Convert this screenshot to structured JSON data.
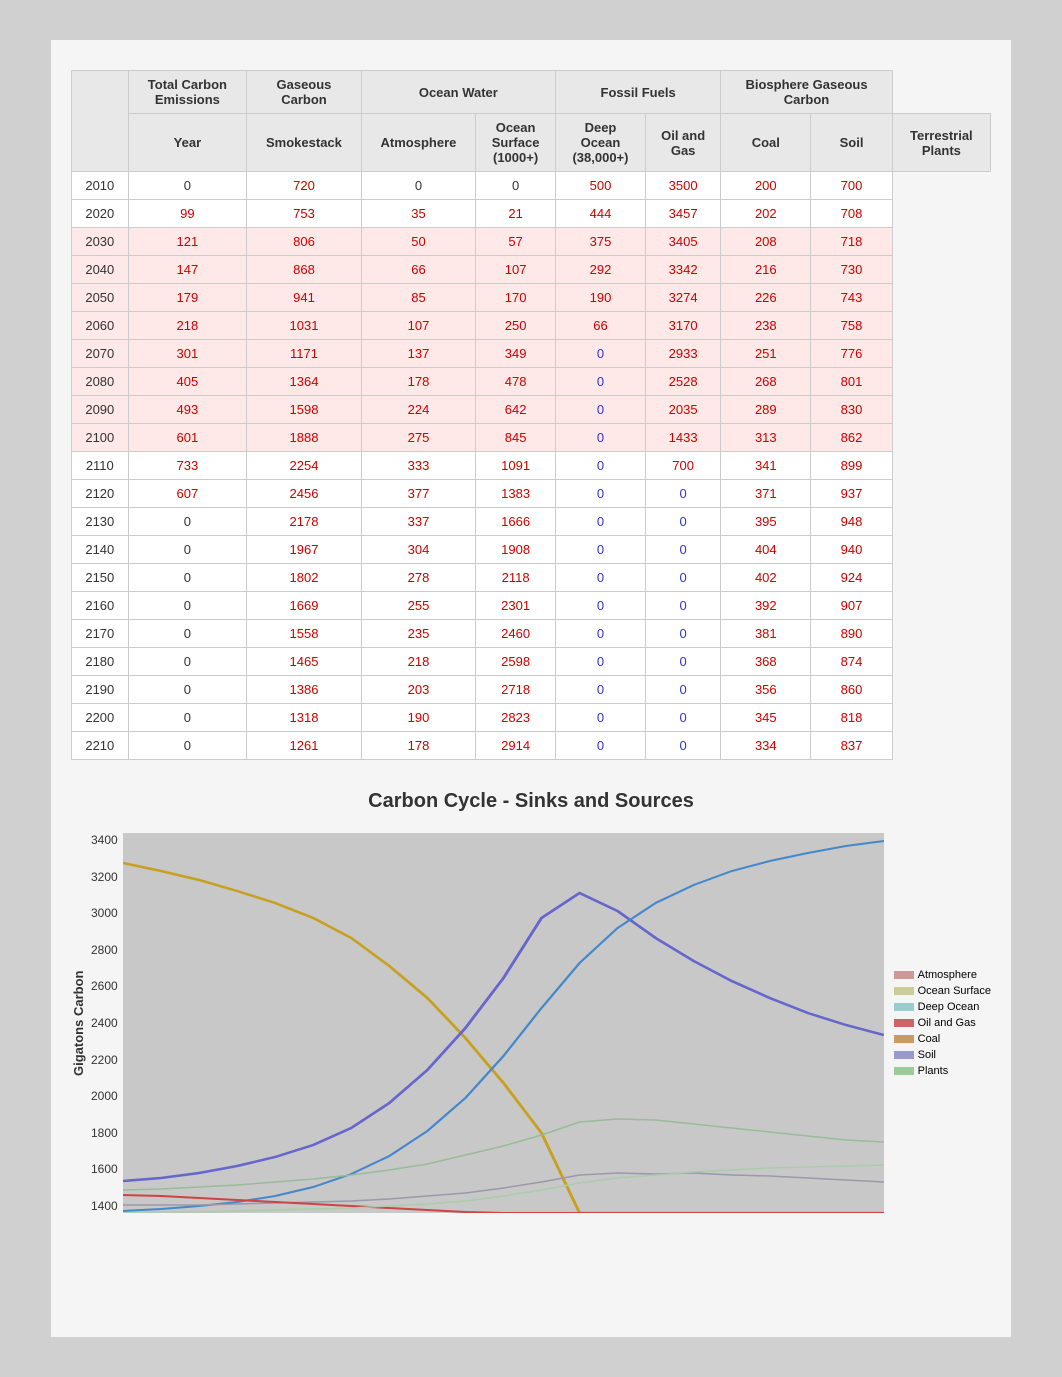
{
  "table": {
    "headers": {
      "row1": [
        {
          "label": "",
          "colspan": 1,
          "rowspan": 2
        },
        {
          "label": "Total Carbon\nEmissions",
          "colspan": 1,
          "rowspan": 1
        },
        {
          "label": "Gaseous\nCarbon",
          "colspan": 1,
          "rowspan": 1
        },
        {
          "label": "Ocean Water",
          "colspan": 2,
          "rowspan": 1
        },
        {
          "label": "Fossil Fuels",
          "colspan": 2,
          "rowspan": 1
        },
        {
          "label": "Biosphere Gaseous\nCarbon",
          "colspan": 2,
          "rowspan": 1
        }
      ],
      "row2": [
        {
          "label": "Year"
        },
        {
          "label": "Smokestack"
        },
        {
          "label": "Atmosphere"
        },
        {
          "label": "Ocean\nSurface\n(1000+)"
        },
        {
          "label": "Deep\nOcean\n(38,000+)"
        },
        {
          "label": "Oil and\nGas"
        },
        {
          "label": "Coal"
        },
        {
          "label": "Soil"
        },
        {
          "label": "Terrestrial\nPlants"
        }
      ]
    },
    "rows": [
      {
        "year": "2010",
        "smokestack": "0",
        "atmosphere": "720",
        "ocean_surface": "0",
        "deep_ocean": "0",
        "oil_gas": "500",
        "coal": "3500",
        "soil": "200",
        "plants": "700",
        "highlight": false
      },
      {
        "year": "2020",
        "smokestack": "99",
        "atmosphere": "753",
        "ocean_surface": "35",
        "deep_ocean": "21",
        "oil_gas": "444",
        "coal": "3457",
        "soil": "202",
        "plants": "708",
        "highlight": false
      },
      {
        "year": "2030",
        "smokestack": "121",
        "atmosphere": "806",
        "ocean_surface": "50",
        "deep_ocean": "57",
        "oil_gas": "375",
        "coal": "3405",
        "soil": "208",
        "plants": "718",
        "highlight": true
      },
      {
        "year": "2040",
        "smokestack": "147",
        "atmosphere": "868",
        "ocean_surface": "66",
        "deep_ocean": "107",
        "oil_gas": "292",
        "coal": "3342",
        "soil": "216",
        "plants": "730",
        "highlight": true
      },
      {
        "year": "2050",
        "smokestack": "179",
        "atmosphere": "941",
        "ocean_surface": "85",
        "deep_ocean": "170",
        "oil_gas": "190",
        "coal": "3274",
        "soil": "226",
        "plants": "743",
        "highlight": true
      },
      {
        "year": "2060",
        "smokestack": "218",
        "atmosphere": "1031",
        "ocean_surface": "107",
        "deep_ocean": "250",
        "oil_gas": "66",
        "coal": "3170",
        "soil": "238",
        "plants": "758",
        "highlight": true
      },
      {
        "year": "2070",
        "smokestack": "301",
        "atmosphere": "1171",
        "ocean_surface": "137",
        "deep_ocean": "349",
        "oil_gas": "0",
        "coal": "2933",
        "soil": "251",
        "plants": "776",
        "highlight": true
      },
      {
        "year": "2080",
        "smokestack": "405",
        "atmosphere": "1364",
        "ocean_surface": "178",
        "deep_ocean": "478",
        "oil_gas": "0",
        "coal": "2528",
        "soil": "268",
        "plants": "801",
        "highlight": true
      },
      {
        "year": "2090",
        "smokestack": "493",
        "atmosphere": "1598",
        "ocean_surface": "224",
        "deep_ocean": "642",
        "oil_gas": "0",
        "coal": "2035",
        "soil": "289",
        "plants": "830",
        "highlight": true
      },
      {
        "year": "2100",
        "smokestack": "601",
        "atmosphere": "1888",
        "ocean_surface": "275",
        "deep_ocean": "845",
        "oil_gas": "0",
        "coal": "1433",
        "soil": "313",
        "plants": "862",
        "highlight": true
      },
      {
        "year": "2110",
        "smokestack": "733",
        "atmosphere": "2254",
        "ocean_surface": "333",
        "deep_ocean": "1091",
        "oil_gas": "0",
        "coal": "700",
        "soil": "341",
        "plants": "899",
        "highlight": false
      },
      {
        "year": "2120",
        "smokestack": "607",
        "atmosphere": "2456",
        "ocean_surface": "377",
        "deep_ocean": "1383",
        "oil_gas": "0",
        "coal": "0",
        "soil": "371",
        "plants": "937",
        "highlight": false
      },
      {
        "year": "2130",
        "smokestack": "0",
        "atmosphere": "2178",
        "ocean_surface": "337",
        "deep_ocean": "1666",
        "oil_gas": "0",
        "coal": "0",
        "soil": "395",
        "plants": "948",
        "highlight": false
      },
      {
        "year": "2140",
        "smokestack": "0",
        "atmosphere": "1967",
        "ocean_surface": "304",
        "deep_ocean": "1908",
        "oil_gas": "0",
        "coal": "0",
        "soil": "404",
        "plants": "940",
        "highlight": false
      },
      {
        "year": "2150",
        "smokestack": "0",
        "atmosphere": "1802",
        "ocean_surface": "278",
        "deep_ocean": "2118",
        "oil_gas": "0",
        "coal": "0",
        "soil": "402",
        "plants": "924",
        "highlight": false
      },
      {
        "year": "2160",
        "smokestack": "0",
        "atmosphere": "1669",
        "ocean_surface": "255",
        "deep_ocean": "2301",
        "oil_gas": "0",
        "coal": "0",
        "soil": "392",
        "plants": "907",
        "highlight": false
      },
      {
        "year": "2170",
        "smokestack": "0",
        "atmosphere": "1558",
        "ocean_surface": "235",
        "deep_ocean": "2460",
        "oil_gas": "0",
        "coal": "0",
        "soil": "381",
        "plants": "890",
        "highlight": false
      },
      {
        "year": "2180",
        "smokestack": "0",
        "atmosphere": "1465",
        "ocean_surface": "218",
        "deep_ocean": "2598",
        "oil_gas": "0",
        "coal": "0",
        "soil": "368",
        "plants": "874",
        "highlight": false
      },
      {
        "year": "2190",
        "smokestack": "0",
        "atmosphere": "1386",
        "ocean_surface": "203",
        "deep_ocean": "2718",
        "oil_gas": "0",
        "coal": "0",
        "soil": "356",
        "plants": "860",
        "highlight": false
      },
      {
        "year": "2200",
        "smokestack": "0",
        "atmosphere": "1318",
        "ocean_surface": "190",
        "deep_ocean": "2823",
        "oil_gas": "0",
        "coal": "0",
        "soil": "345",
        "plants": "818",
        "highlight": false
      },
      {
        "year": "2210",
        "smokestack": "0",
        "atmosphere": "1261",
        "ocean_surface": "178",
        "deep_ocean": "2914",
        "oil_gas": "0",
        "coal": "0",
        "soil": "334",
        "plants": "837",
        "highlight": false
      }
    ]
  },
  "chart": {
    "title": "Carbon Cycle - Sinks and Sources",
    "y_label": "Gigatons Carbon",
    "y_axis": [
      "3400",
      "3200",
      "3000",
      "2800",
      "2600",
      "2400",
      "2200",
      "2000",
      "1800",
      "1600",
      "1400"
    ],
    "legend": [
      {
        "label": "Atmosphere",
        "color": "#cc9999"
      },
      {
        "label": "Ocean Surface",
        "color": "#cccc99"
      },
      {
        "label": "Deep Ocean",
        "color": "#99cccc"
      },
      {
        "label": "Oil and Gas",
        "color": "#cc6666"
      },
      {
        "label": "Coal",
        "color": "#cc9966"
      },
      {
        "label": "Soil",
        "color": "#9999cc"
      },
      {
        "label": "Plants",
        "color": "#99cc99"
      }
    ]
  }
}
